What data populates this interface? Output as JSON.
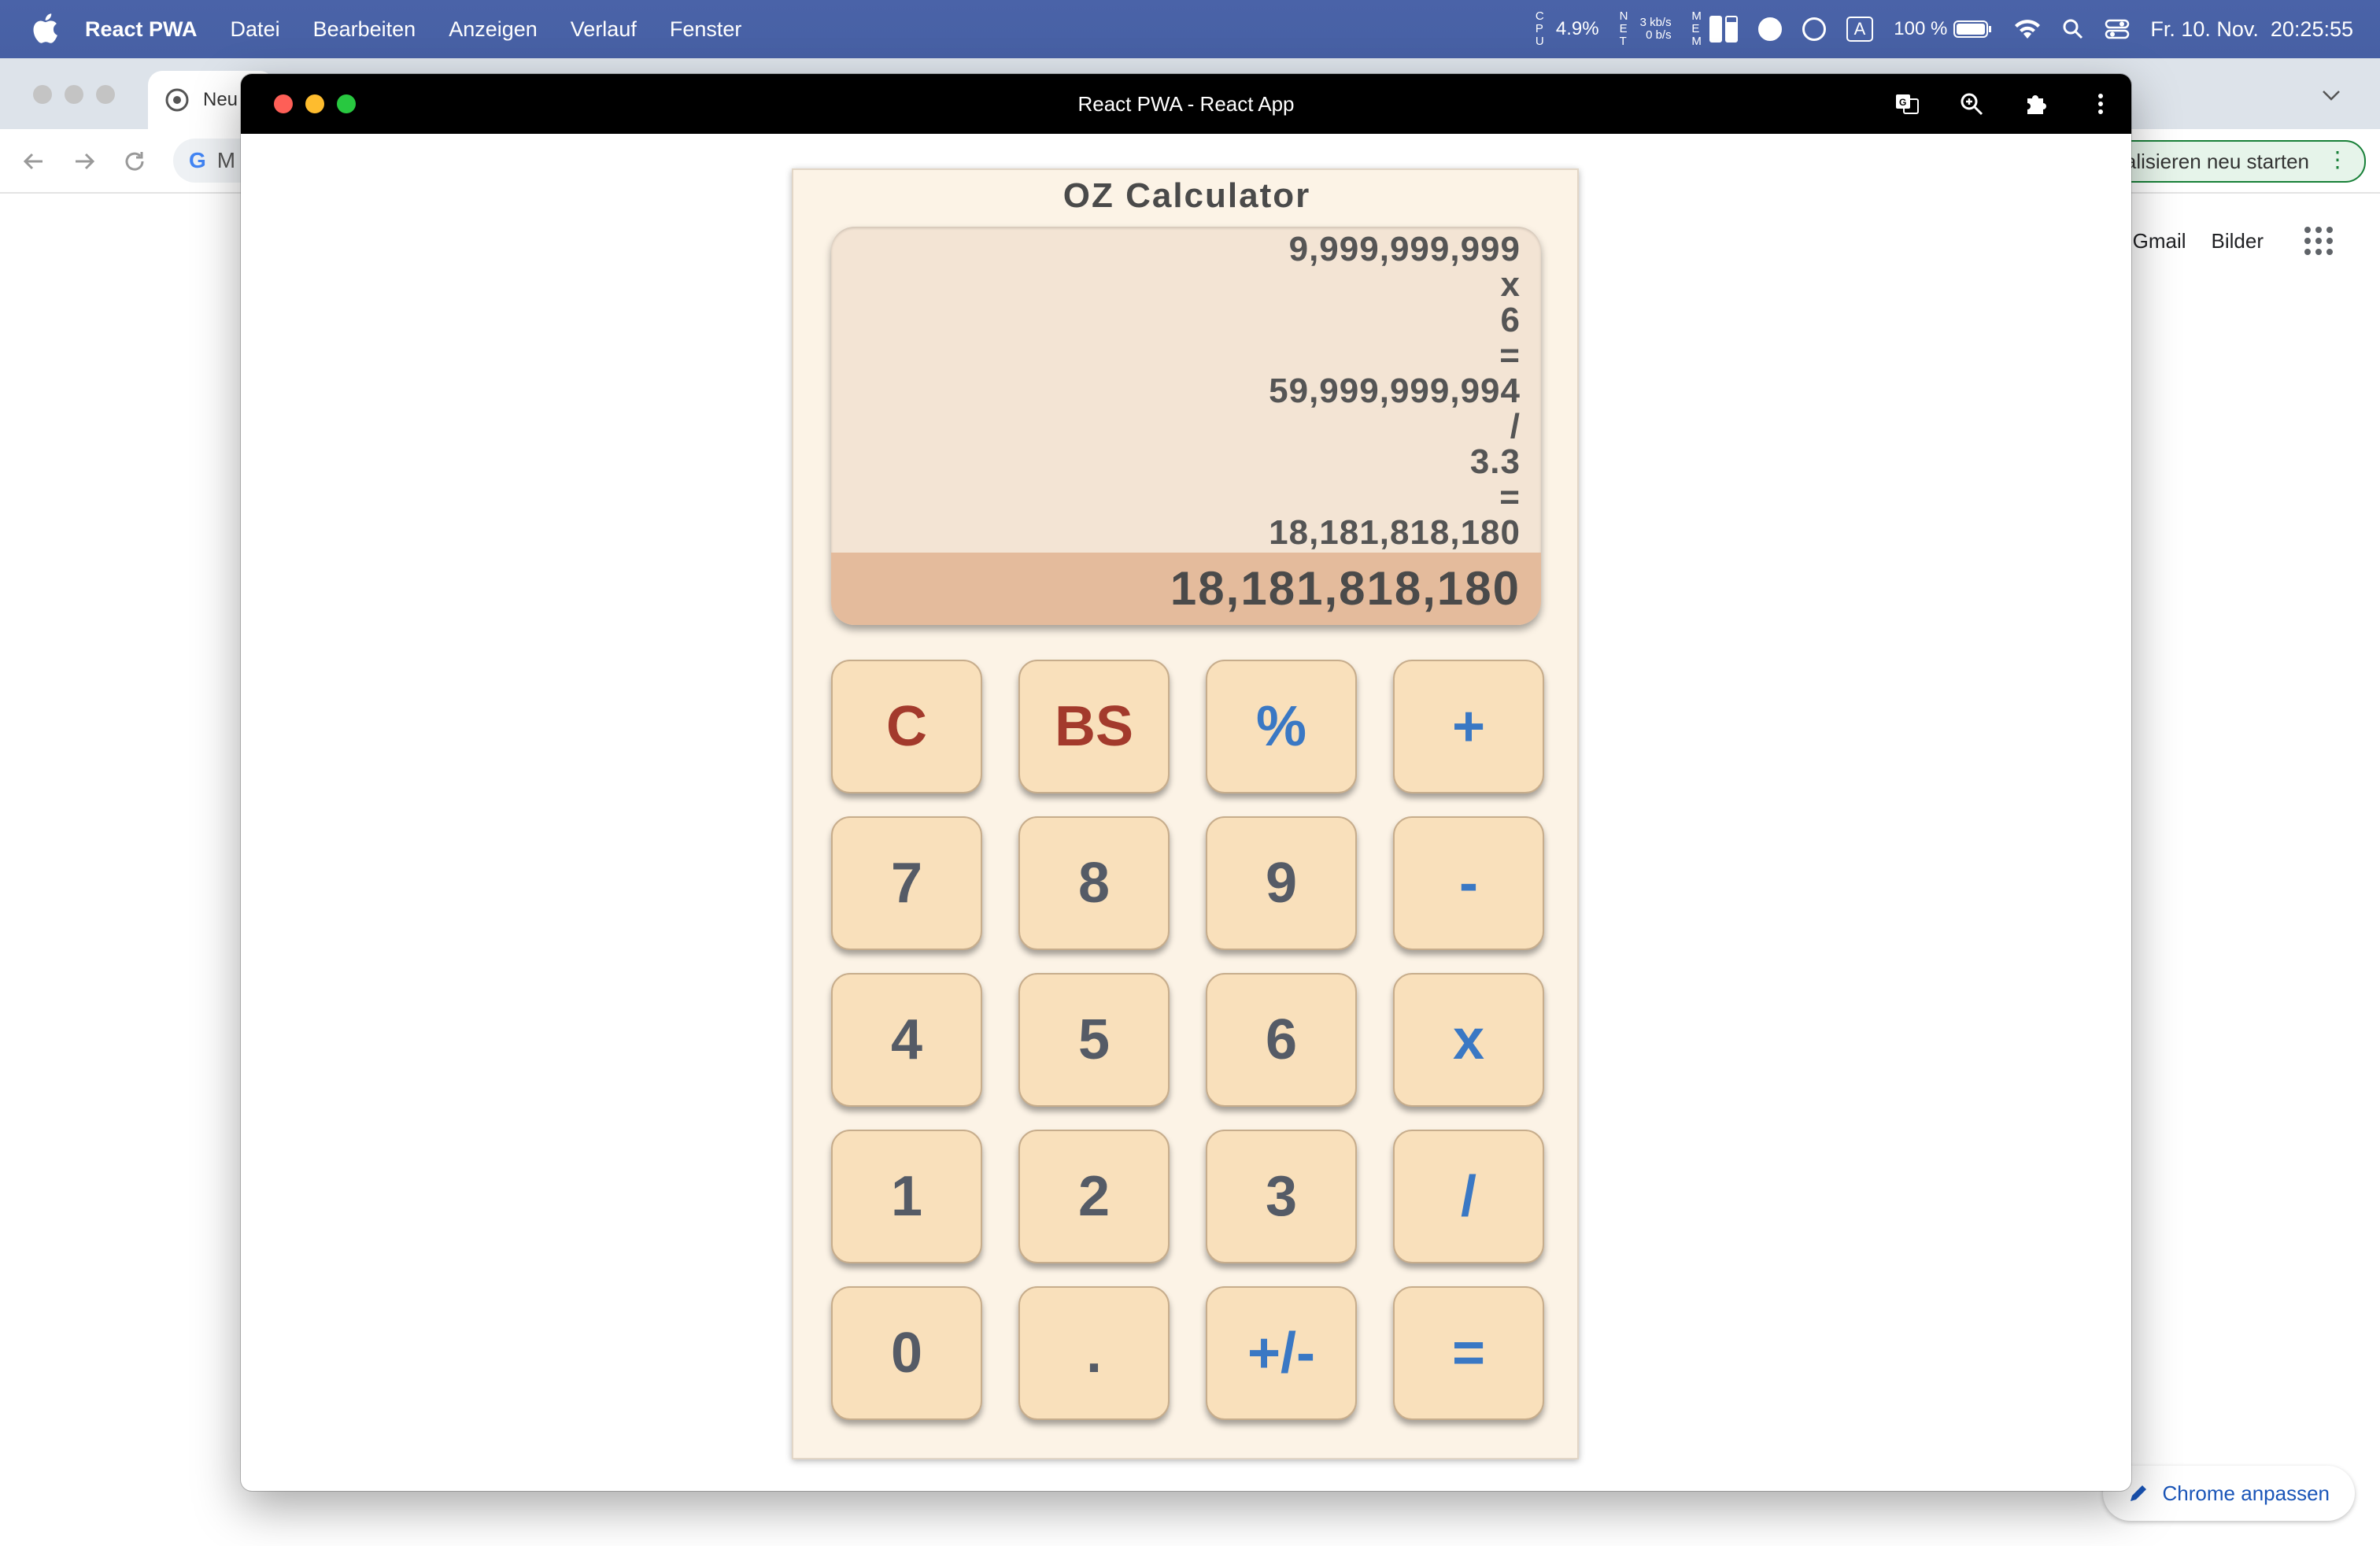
{
  "menubar": {
    "app_name": "React PWA",
    "menus": [
      "Datei",
      "Bearbeiten",
      "Anzeigen",
      "Verlauf",
      "Fenster"
    ],
    "cpu_label": "C P U",
    "cpu_value": "4.9%",
    "net_label": "N E T",
    "net_up": "3 kb/s",
    "net_down": "0 b/s",
    "mem_label": "M E M",
    "input_source": "A",
    "battery": "100 %",
    "datetime": "Fr. 10. Nov.  20:25:55"
  },
  "background_browser": {
    "tab_label": "Neu",
    "address_fragment": "M",
    "restart_button": "alisieren neu starten",
    "links": [
      "Gmail",
      "Bilder"
    ],
    "customize_button": "Chrome anpassen"
  },
  "pwa": {
    "window_title": "React PWA - React App",
    "calculator": {
      "title": "OZ Calculator",
      "history": [
        "9,999,999,999",
        "x",
        "6",
        "=",
        "59,999,999,994",
        "/",
        "3.3",
        "=",
        "18,181,818,180"
      ],
      "result": "18,181,818,180",
      "keys": [
        {
          "label": "C",
          "style": "red"
        },
        {
          "label": "BS",
          "style": "red"
        },
        {
          "label": "%",
          "style": "op"
        },
        {
          "label": "+",
          "style": "op"
        },
        {
          "label": "7",
          "style": "num"
        },
        {
          "label": "8",
          "style": "num"
        },
        {
          "label": "9",
          "style": "num"
        },
        {
          "label": "-",
          "style": "op"
        },
        {
          "label": "4",
          "style": "num"
        },
        {
          "label": "5",
          "style": "num"
        },
        {
          "label": "6",
          "style": "num"
        },
        {
          "label": "x",
          "style": "op"
        },
        {
          "label": "1",
          "style": "num"
        },
        {
          "label": "2",
          "style": "num"
        },
        {
          "label": "3",
          "style": "num"
        },
        {
          "label": "/",
          "style": "op"
        },
        {
          "label": "0",
          "style": "num"
        },
        {
          "label": ".",
          "style": "num"
        },
        {
          "label": "+/-",
          "style": "op"
        },
        {
          "label": "=",
          "style": "op"
        }
      ]
    }
  },
  "colors": {
    "menubar_blue": "#4a63a8",
    "key_bg": "#f9e0bb",
    "key_number_text": "#555b66",
    "key_operator_text": "#3a78c4",
    "key_clear_text": "#a33a2c",
    "display_bg": "#f3e4d4",
    "result_bg": "#e4bb9c",
    "calculator_bg": "#fcf3e6"
  }
}
